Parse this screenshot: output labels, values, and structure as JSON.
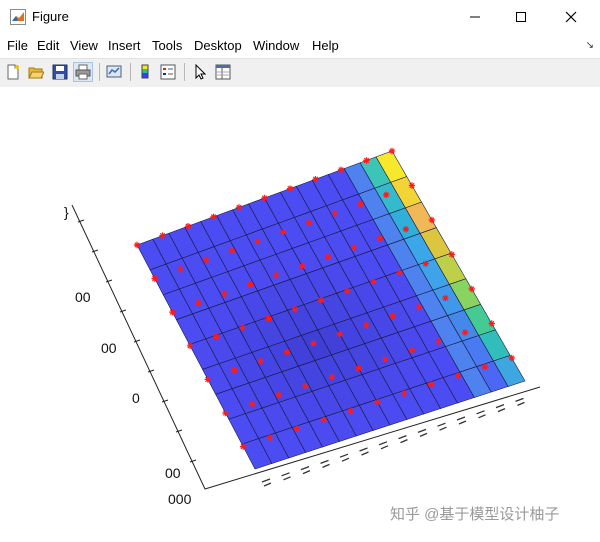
{
  "window": {
    "title": "Figure"
  },
  "menu": [
    "File",
    "Edit",
    "View",
    "Insert",
    "Tools",
    "Desktop",
    "Window",
    "Help"
  ],
  "toolbar_icons": [
    "new-figure-icon",
    "open-file-icon",
    "save-icon",
    "print-icon",
    "link-plot-icon",
    "insert-colorbar-icon",
    "insert-legend-icon",
    "edit-plot-icon",
    "property-inspector-icon"
  ],
  "axis": {
    "tick_labels": [
      "}",
      "00",
      "00",
      "0",
      "00",
      "000"
    ]
  },
  "colors": {
    "surface_low": "#3d3df2",
    "surface_high": "#f7e61a",
    "markers": "#ff1a1a",
    "mesh": "#1a1a40"
  },
  "watermark": "知乎 @基于模型设计柚子"
}
